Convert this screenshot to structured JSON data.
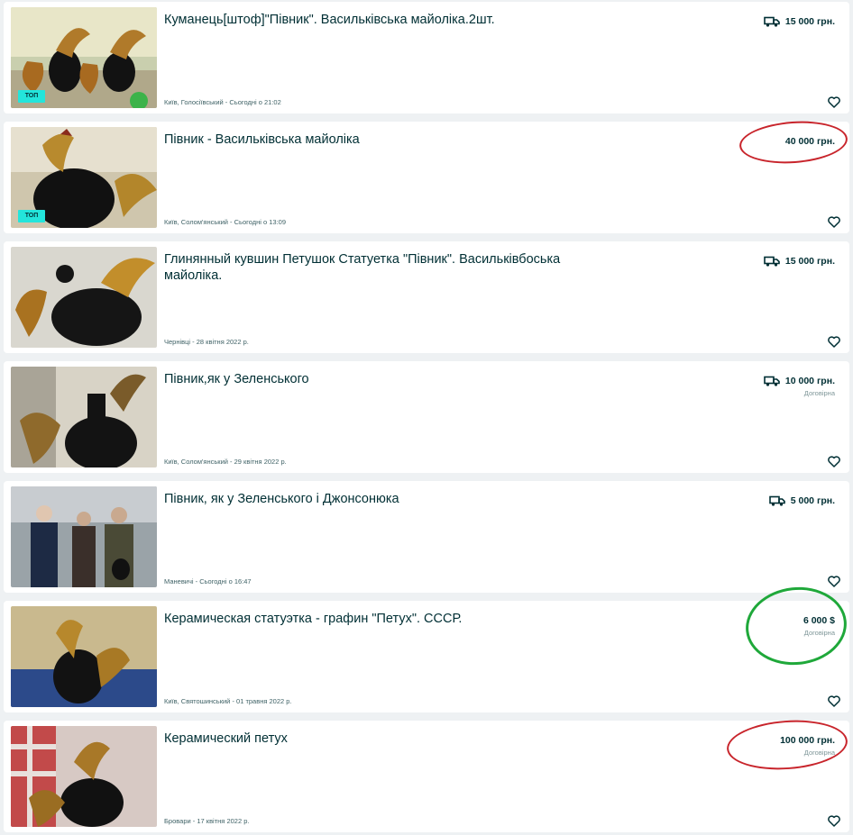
{
  "listings": [
    {
      "title": "Куманець[штоф]\"Півник\". Васильківська майоліка.2шт.",
      "meta": "Київ, Голосіївський - Сьогодні о 21:02",
      "price": "15 000 грн.",
      "negotiable": "",
      "delivery": true,
      "top_badge": "ТОП"
    },
    {
      "title": "Півник - Васильківська майоліка",
      "meta": "Київ, Солом'янський - Сьогодні о 13:09",
      "price": "40 000 грн.",
      "negotiable": "",
      "delivery": false,
      "top_badge": "ТОП",
      "highlight": "red"
    },
    {
      "title": "Глинянный кувшин Петушок Статуетка \"Півник\". Васильківбоська майоліка.",
      "meta": "Чернівці - 28 квітня 2022 р.",
      "price": "15 000 грн.",
      "negotiable": "",
      "delivery": true,
      "top_badge": ""
    },
    {
      "title": "Півник,як у Зеленського",
      "meta": "Київ, Солом'янський - 29 квітня 2022 р.",
      "price": "10 000 грн.",
      "negotiable": "Договірна",
      "delivery": true,
      "top_badge": ""
    },
    {
      "title": "Півник, як у Зеленського і Джонсонюка",
      "meta": "Маневичі - Сьогодні о 16:47",
      "price": "5 000 грн.",
      "negotiable": "",
      "delivery": true,
      "top_badge": ""
    },
    {
      "title": "Керамическая статуэтка - графин \"Петух\". СССР.",
      "meta": "Київ, Святошинський - 01 травня 2022 р.",
      "price": "6 000 $",
      "negotiable": "Договірна",
      "delivery": false,
      "top_badge": "",
      "highlight": "green"
    },
    {
      "title": "Керамический петух",
      "meta": "Бровари - 17 квітня 2022 р.",
      "price": "100 000 грн.",
      "negotiable": "Договірна",
      "delivery": false,
      "top_badge": "",
      "highlight": "red"
    }
  ],
  "icons": {
    "delivery": "truck-icon",
    "favorite": "heart-outline-icon"
  },
  "colors": {
    "badge_top": "#23e5db",
    "highlight_red": "#c8242b",
    "highlight_green": "#1fa83a",
    "text": "#002f34"
  }
}
